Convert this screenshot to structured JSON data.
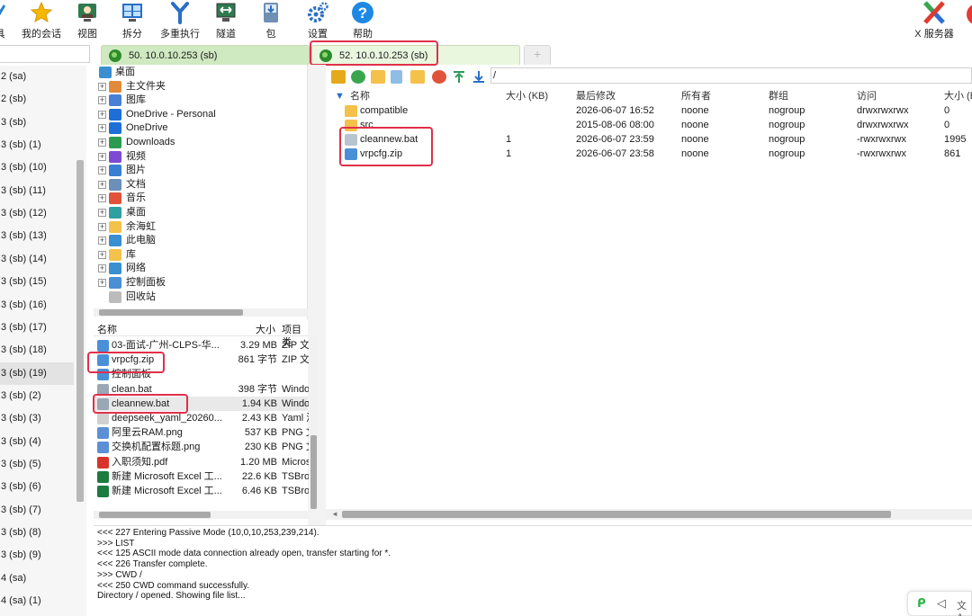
{
  "toolbar": {
    "items": [
      {
        "label": "具",
        "icon": "tools-icon"
      },
      {
        "label": "我的会话",
        "icon": "star-icon"
      },
      {
        "label": "视图",
        "icon": "view-icon"
      },
      {
        "label": "拆分",
        "icon": "split-icon"
      },
      {
        "label": "多重执行",
        "icon": "multi-exec-icon"
      },
      {
        "label": "隧道",
        "icon": "tunnel-icon"
      },
      {
        "label": "包",
        "icon": "package-icon"
      },
      {
        "label": "设置",
        "icon": "settings-gear-icon"
      },
      {
        "label": "帮助",
        "icon": "help-icon"
      },
      {
        "label": "X 服务器",
        "icon": "x-server-icon"
      }
    ]
  },
  "sessions": [
    "2 (sa)",
    "2 (sb)",
    "3 (sb)",
    "3 (sb) (1)",
    "3 (sb) (10)",
    "3 (sb) (11)",
    "3 (sb) (12)",
    "3 (sb) (13)",
    "3 (sb) (14)",
    "3 (sb) (15)",
    "3 (sb) (16)",
    "3 (sb) (17)",
    "3 (sb) (18)",
    "3 (sb) (19)",
    "3 (sb) (2)",
    "3 (sb) (3)",
    "3 (sb) (4)",
    "3 (sb) (5)",
    "3 (sb) (6)",
    "3 (sb) (7)",
    "3 (sb) (8)",
    "3 (sb) (9)",
    "4 (sa)",
    "4 (sa) (1)"
  ],
  "tabs": [
    {
      "label": "50. 10.0.10.253 (sb)"
    },
    {
      "label": "52. 10.0.10.253 (sb)"
    }
  ],
  "local_tree": [
    {
      "label": "桌面",
      "color": "#3a8fd1"
    },
    {
      "label": "主文件夹",
      "color": "#e28a3b"
    },
    {
      "label": "图库",
      "color": "#4a7fd6"
    },
    {
      "label": "OneDrive - Personal",
      "color": "#1d6fd6"
    },
    {
      "label": "OneDrive",
      "color": "#1d6fd6"
    },
    {
      "label": "Downloads",
      "color": "#2d9b4e"
    },
    {
      "label": "视频",
      "color": "#7c4bd1"
    },
    {
      "label": "图片",
      "color": "#3a7fd1"
    },
    {
      "label": "文档",
      "color": "#6b8fb8"
    },
    {
      "label": "音乐",
      "color": "#e0533a"
    },
    {
      "label": "桌面",
      "color": "#2fa0a0"
    },
    {
      "label": "余海虹",
      "color": "#f2c24a"
    },
    {
      "label": "此电脑",
      "color": "#3a8fd1"
    },
    {
      "label": "库",
      "color": "#f2c24a"
    },
    {
      "label": "网络",
      "color": "#3a8fd1"
    },
    {
      "label": "控制面板",
      "color": "#4a8fd6"
    },
    {
      "label": "回收站",
      "color": "#bbbbbb"
    }
  ],
  "local_files": {
    "headers": {
      "name": "名称",
      "size": "大小",
      "type": "项目类"
    },
    "rows": [
      {
        "name": "03-面试-广州-CLPS-华...",
        "size": "3.29 MB",
        "type": "ZIP 文",
        "color": "#4a90d9"
      },
      {
        "name": "vrpcfg.zip",
        "size": "861 字节",
        "type": "ZIP 文",
        "color": "#4a90d9"
      },
      {
        "name": "控制面板",
        "size": "",
        "type": "",
        "color": "#4a8fd6"
      },
      {
        "name": "clean.bat",
        "size": "398 字节",
        "type": "Windo",
        "color": "#9aa7b4"
      },
      {
        "name": "cleannew.bat",
        "size": "1.94 KB",
        "type": "Windo",
        "color": "#9aa7b4"
      },
      {
        "name": "deepseek_yaml_20260...",
        "size": "2.43 KB",
        "type": "Yaml 涉",
        "color": "#d0d0d0"
      },
      {
        "name": "阿里云RAM.png",
        "size": "537 KB",
        "type": "PNG 文",
        "color": "#5b8fd6"
      },
      {
        "name": "交换机配置标题.png",
        "size": "230 KB",
        "type": "PNG 文",
        "color": "#5b8fd6"
      },
      {
        "name": "入职须知.pdf",
        "size": "1.20 MB",
        "type": "Micros",
        "color": "#d8332a"
      },
      {
        "name": "新建 Microsoft Excel 工...",
        "size": "22.6 KB",
        "type": "TSBro",
        "color": "#1f7a3f"
      },
      {
        "name": "新建 Microsoft Excel 工...",
        "size": "6.46 KB",
        "type": "TSBro",
        "color": "#1f7a3f"
      }
    ]
  },
  "remote": {
    "path": "/",
    "headers": {
      "name": "名称",
      "size": "大小 (KB)",
      "modified": "最后修改",
      "owner": "所有者",
      "group": "群组",
      "access": "访问",
      "size2": "大小 (B"
    },
    "rows": [
      {
        "name": "compatible",
        "size": "",
        "modified": "2026-06-07 16:52",
        "owner": "noone",
        "group": "nogroup",
        "access": "drwxrwxrwx",
        "size2": "0",
        "kind": "folder"
      },
      {
        "name": "src",
        "size": "",
        "modified": "2015-08-06 08:00",
        "owner": "noone",
        "group": "nogroup",
        "access": "drwxrwxrwx",
        "size2": "0",
        "kind": "folder"
      },
      {
        "name": "cleannew.bat",
        "size": "1",
        "modified": "2026-06-07 23:59",
        "owner": "noone",
        "group": "nogroup",
        "access": "-rwxrwxrwx",
        "size2": "1995",
        "kind": "bat"
      },
      {
        "name": "vrpcfg.zip",
        "size": "1",
        "modified": "2026-06-07 23:58",
        "owner": "noone",
        "group": "nogroup",
        "access": "-rwxrwxrwx",
        "size2": "861",
        "kind": "zip"
      }
    ]
  },
  "log": [
    "<<<  227 Entering Passive Mode (10,0,10,253,239,214).",
    ">>>  LIST",
    "<<<  125 ASCII mode data connection already open, transfer starting for *.",
    "<<<  226 Transfer complete.",
    ">>>  CWD /",
    "<<<  250 CWD command successfully.",
    "Directory / opened. Showing file list..."
  ],
  "colors": {
    "accent": "#e0304a",
    "tab_active": "#cfe9c1",
    "folder": "#f4c14b"
  }
}
